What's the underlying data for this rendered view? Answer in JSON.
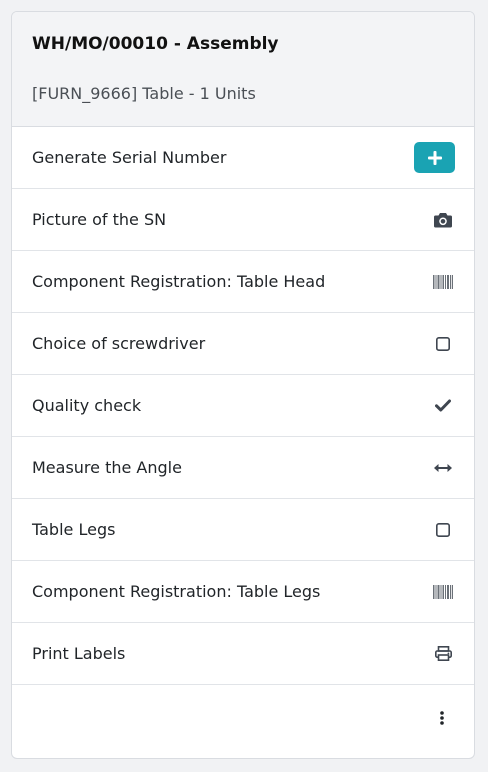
{
  "header": {
    "title": "WH/MO/00010 - Assembly",
    "subtitle": "[FURN_9666] Table - 1 Units"
  },
  "steps": [
    {
      "label": "Generate Serial Number",
      "icon": "plus-icon"
    },
    {
      "label": "Picture of the SN",
      "icon": "camera-icon"
    },
    {
      "label": "Component Registration: Table Head",
      "icon": "barcode-icon"
    },
    {
      "label": "Choice of screwdriver",
      "icon": "checkbox-icon"
    },
    {
      "label": "Quality check",
      "icon": "check-icon"
    },
    {
      "label": "Measure the Angle",
      "icon": "arrows-horizontal-icon"
    },
    {
      "label": "Table Legs",
      "icon": "checkbox-icon"
    },
    {
      "label": "Component Registration: Table Legs",
      "icon": "barcode-icon"
    },
    {
      "label": "Print Labels",
      "icon": "print-icon"
    }
  ],
  "footer": {
    "menu_icon": "kebab-menu-icon"
  },
  "colors": {
    "accent": "#1aa3b3",
    "icon": "#3f4650",
    "header_bg": "#f3f4f6"
  }
}
